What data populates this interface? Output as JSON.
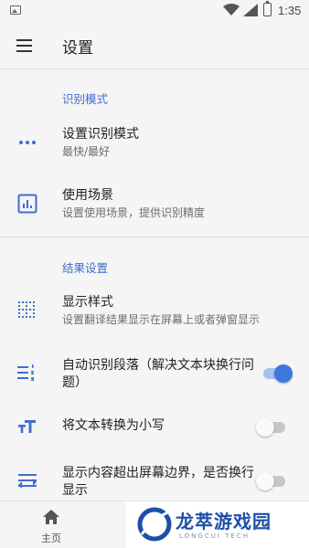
{
  "status_bar": {
    "time": "1:35"
  },
  "app_bar": {
    "title": "设置"
  },
  "sections": {
    "recognition": {
      "header": "识别模式",
      "items": [
        {
          "title": "设置识别模式",
          "subtitle": "最快/最好",
          "icon": "more-horiz-icon"
        },
        {
          "title": "使用场景",
          "subtitle": "设置使用场景，提供识别精度",
          "icon": "insert-chart-icon"
        }
      ]
    },
    "results": {
      "header": "结果设置",
      "items": [
        {
          "title": "显示样式",
          "subtitle": "设置翻译结果显示在屏幕上或者弹窗显示",
          "icon": "dotted-grid-icon"
        },
        {
          "title": "自动识别段落（解决文本块换行问题）",
          "icon": "format-list-numbered-icon",
          "switch": true
        },
        {
          "title": "将文本转换为小写",
          "icon": "text-size-icon",
          "switch": false
        },
        {
          "title": "显示内容超出屏幕边界，是否换行显示",
          "icon": "wrap-text-icon",
          "switch": false
        }
      ]
    }
  },
  "bottom_nav": {
    "home_label": "主页"
  },
  "watermark": {
    "text": "龙萃游戏园",
    "sub": "LONGCUI TECH"
  },
  "colors": {
    "accent": "#3f6fcf",
    "switch_on": "#3d78df"
  }
}
